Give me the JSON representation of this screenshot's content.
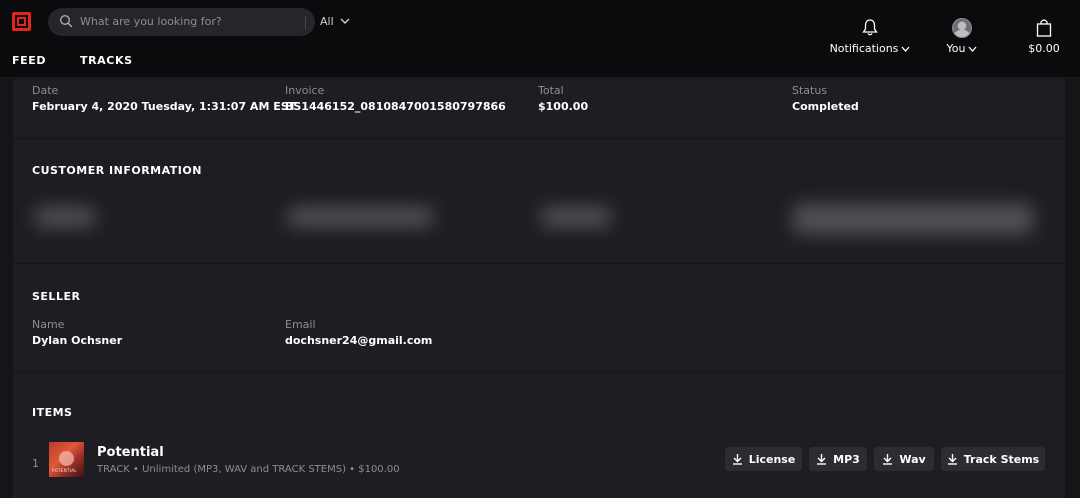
{
  "colors": {
    "brand_red": "#e4251b",
    "topbar_bg": "#0b0a0c",
    "panel_bg": "#1e1d21",
    "muted_text": "#8e8d93"
  },
  "header": {
    "search": {
      "placeholder": "What are you looking for?",
      "filter": "All"
    },
    "nav": {
      "feed": "FEED",
      "tracks": "TRACKS"
    },
    "notifications": "Notifications",
    "you": "You",
    "cart_total": "$0.00"
  },
  "order": {
    "date_label": "Date",
    "date": "February 4, 2020 Tuesday, 1:31:07 AM EST",
    "invoice_label": "Invoice",
    "invoice": "BS1446152_0810847001580797866",
    "total_label": "Total",
    "total": "$100.00",
    "status_label": "Status",
    "status": "Completed"
  },
  "customer": {
    "title": "CUSTOMER INFORMATION"
  },
  "seller": {
    "title": "SELLER",
    "name_label": "Name",
    "name": "Dylan Ochsner",
    "email_label": "Email",
    "email": "dochsner24@gmail.com"
  },
  "items": {
    "title": "ITEMS",
    "list": [
      {
        "index": "1",
        "cover_caption": "POTENTIAL",
        "name": "Potential",
        "meta": "TRACK • Unlimited (MP3, WAV and TRACK STEMS) • $100.00",
        "actions": [
          "License",
          "MP3",
          "Wav",
          "Track Stems"
        ]
      }
    ]
  }
}
